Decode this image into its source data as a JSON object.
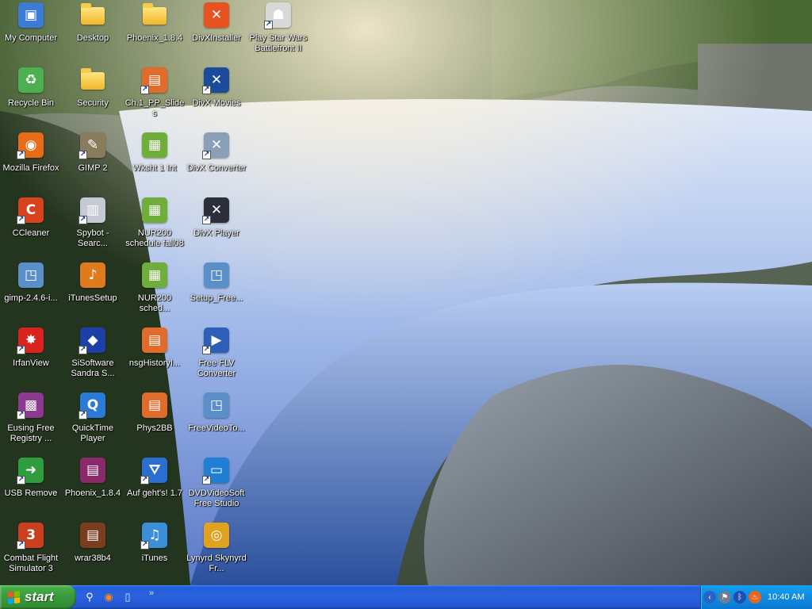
{
  "desktop": {
    "icons": [
      {
        "label": "My Computer",
        "icon": "my-computer-icon",
        "color": "#3a7bd5",
        "glyph": "▣",
        "shortcut": false,
        "type": "app"
      },
      {
        "label": "Desktop",
        "icon": "folder-icon",
        "color": "#f0b72a",
        "glyph": "",
        "shortcut": false,
        "type": "folder"
      },
      {
        "label": "Phoenix_1.8.4",
        "icon": "folder-icon",
        "color": "#f0b72a",
        "glyph": "",
        "shortcut": false,
        "type": "folder"
      },
      {
        "label": "DivXInstaller",
        "icon": "divx-installer-icon",
        "color": "#e8521e",
        "glyph": "✕",
        "shortcut": false,
        "type": "app"
      },
      {
        "label": "Play Star Wars Battlefront II",
        "icon": "star-wars-trooper-icon",
        "color": "#d8d8d8",
        "glyph": "☗",
        "shortcut": true,
        "type": "app"
      },
      {
        "label": "Recycle Bin",
        "icon": "recycle-bin-icon",
        "color": "#4caf50",
        "glyph": "♻",
        "shortcut": false,
        "type": "app"
      },
      {
        "label": "Security",
        "icon": "folder-icon",
        "color": "#f0b72a",
        "glyph": "",
        "shortcut": false,
        "type": "folder"
      },
      {
        "label": "Ch.1_PP_Slides",
        "icon": "powerpoint-file-icon",
        "color": "#e06b2a",
        "glyph": "▤",
        "shortcut": true,
        "type": "app"
      },
      {
        "label": "DivX Movies",
        "icon": "divx-movies-icon",
        "color": "#1b4c9c",
        "glyph": "✕",
        "shortcut": true,
        "type": "app"
      },
      {
        "label": "",
        "icon": "",
        "color": "",
        "glyph": "",
        "shortcut": false,
        "type": "empty"
      },
      {
        "label": "Mozilla Firefox",
        "icon": "firefox-icon",
        "color": "#e86b16",
        "glyph": "◉",
        "shortcut": true,
        "type": "app"
      },
      {
        "label": "GIMP 2",
        "icon": "gimp-icon",
        "color": "#8a7b5c",
        "glyph": "✎",
        "shortcut": true,
        "type": "app"
      },
      {
        "label": "Wksht 1 Int",
        "icon": "spreadsheet-file-icon",
        "color": "#6fae3a",
        "glyph": "▦",
        "shortcut": false,
        "type": "app"
      },
      {
        "label": "DivX Converter",
        "icon": "divx-converter-icon",
        "color": "#8aa0b8",
        "glyph": "✕",
        "shortcut": true,
        "type": "app"
      },
      {
        "label": "",
        "icon": "",
        "color": "",
        "glyph": "",
        "shortcut": false,
        "type": "empty"
      },
      {
        "label": "CCleaner",
        "icon": "ccleaner-icon",
        "color": "#d8431e",
        "glyph": "C",
        "shortcut": true,
        "type": "app"
      },
      {
        "label": "Spybot - Searc...",
        "icon": "spybot-icon",
        "color": "#c4c9d4",
        "glyph": "▥",
        "shortcut": true,
        "type": "app"
      },
      {
        "label": "NUR200 schedule fall08",
        "icon": "spreadsheet-file-icon",
        "color": "#6fae3a",
        "glyph": "▦",
        "shortcut": false,
        "type": "app"
      },
      {
        "label": "DivX Player",
        "icon": "divx-player-icon",
        "color": "#2a2f3a",
        "glyph": "✕",
        "shortcut": true,
        "type": "app"
      },
      {
        "label": "",
        "icon": "",
        "color": "",
        "glyph": "",
        "shortcut": false,
        "type": "empty"
      },
      {
        "label": "gimp-2.4.6-i...",
        "icon": "installer-icon",
        "color": "#5b8fc9",
        "glyph": "◳",
        "shortcut": false,
        "type": "app"
      },
      {
        "label": "iTunesSetup",
        "icon": "itunes-setup-icon",
        "color": "#e07a1e",
        "glyph": "♪",
        "shortcut": false,
        "type": "app"
      },
      {
        "label": "NUR200 sched...",
        "icon": "spreadsheet-file-icon",
        "color": "#6fae3a",
        "glyph": "▦",
        "shortcut": false,
        "type": "app"
      },
      {
        "label": "Setup_Free...",
        "icon": "installer-icon",
        "color": "#5b8fc9",
        "glyph": "◳",
        "shortcut": false,
        "type": "app"
      },
      {
        "label": "",
        "icon": "",
        "color": "",
        "glyph": "",
        "shortcut": false,
        "type": "empty"
      },
      {
        "label": "IrfanView",
        "icon": "irfanview-icon",
        "color": "#d8231e",
        "glyph": "✸",
        "shortcut": true,
        "type": "app"
      },
      {
        "label": "SiSoftware Sandra S...",
        "icon": "sisoftware-sandra-icon",
        "color": "#1d3fa8",
        "glyph": "◆",
        "shortcut": true,
        "type": "app"
      },
      {
        "label": "nsgHistoryI...",
        "icon": "powerpoint-file-icon",
        "color": "#e06b2a",
        "glyph": "▤",
        "shortcut": false,
        "type": "app"
      },
      {
        "label": "Free FLV Converter",
        "icon": "flv-converter-icon",
        "color": "#2d5fb8",
        "glyph": "▶",
        "shortcut": true,
        "type": "app"
      },
      {
        "label": "",
        "icon": "",
        "color": "",
        "glyph": "",
        "shortcut": false,
        "type": "empty"
      },
      {
        "label": "Eusing Free Registry ...",
        "icon": "registry-cleaner-icon",
        "color": "#8b3a8f",
        "glyph": "▩",
        "shortcut": true,
        "type": "app"
      },
      {
        "label": "QuickTime Player",
        "icon": "quicktime-icon",
        "color": "#2a7bd8",
        "glyph": "Q",
        "shortcut": true,
        "type": "app"
      },
      {
        "label": "Phys2BB",
        "icon": "powerpoint-file-icon",
        "color": "#e06b2a",
        "glyph": "▤",
        "shortcut": false,
        "type": "app"
      },
      {
        "label": "FreeVideoTo...",
        "icon": "installer-icon",
        "color": "#5b8fc9",
        "glyph": "◳",
        "shortcut": false,
        "type": "app"
      },
      {
        "label": "",
        "icon": "",
        "color": "",
        "glyph": "",
        "shortcut": false,
        "type": "empty"
      },
      {
        "label": "USB Remove",
        "icon": "usb-remove-icon",
        "color": "#2e9e3c",
        "glyph": "➜",
        "shortcut": true,
        "type": "app"
      },
      {
        "label": "Phoenix_1.8.4",
        "icon": "winrar-archive-icon",
        "color": "#8b2a6a",
        "glyph": "▤",
        "shortcut": false,
        "type": "app"
      },
      {
        "label": "Auf geht's! 1.7",
        "icon": "auf-gehts-icon",
        "color": "#2a6fd0",
        "glyph": "⛛",
        "shortcut": true,
        "type": "app"
      },
      {
        "label": "DVDVideoSoft Free Studio",
        "icon": "dvdvideosoft-icon",
        "color": "#1f7fd4",
        "glyph": "▭",
        "shortcut": true,
        "type": "app"
      },
      {
        "label": "",
        "icon": "",
        "color": "",
        "glyph": "",
        "shortcut": false,
        "type": "empty"
      },
      {
        "label": "Combat Flight Simulator 3",
        "icon": "combat-flight-sim-icon",
        "color": "#c8401e",
        "glyph": "3",
        "shortcut": true,
        "type": "app"
      },
      {
        "label": "wrar38b4",
        "icon": "winrar-installer-icon",
        "color": "#7a3e1e",
        "glyph": "▤",
        "shortcut": false,
        "type": "app"
      },
      {
        "label": "iTunes",
        "icon": "itunes-icon",
        "color": "#3a8fd8",
        "glyph": "♫",
        "shortcut": true,
        "type": "app"
      },
      {
        "label": "Lynyrd Skynyrd Fr...",
        "icon": "media-file-icon",
        "color": "#e0a21e",
        "glyph": "◎",
        "shortcut": false,
        "type": "app"
      },
      {
        "label": "",
        "icon": "",
        "color": "",
        "glyph": "",
        "shortcut": false,
        "type": "empty"
      }
    ]
  },
  "taskbar": {
    "start_label": "start",
    "quick_launch": [
      {
        "icon": "search-icon",
        "glyph": "⚲"
      },
      {
        "icon": "firefox-icon",
        "glyph": "◉"
      },
      {
        "icon": "show-desktop-icon",
        "glyph": "▯"
      }
    ],
    "chevron": "»",
    "tray_icons": [
      {
        "icon": "tray-collapse-icon",
        "glyph": "‹",
        "color": "#2a62c8"
      },
      {
        "icon": "network-icon",
        "glyph": "⚑",
        "color": "#6e7d8f"
      },
      {
        "icon": "bluetooth-icon",
        "glyph": "ᛒ",
        "color": "#1e4fb0"
      },
      {
        "icon": "flame-icon",
        "glyph": "♨",
        "color": "#e8651e"
      }
    ],
    "clock": "10:40 AM"
  },
  "colors": {
    "taskbar_blue": "#245edb",
    "start_green": "#3c9a3e",
    "tray_blue": "#0f8be0"
  }
}
